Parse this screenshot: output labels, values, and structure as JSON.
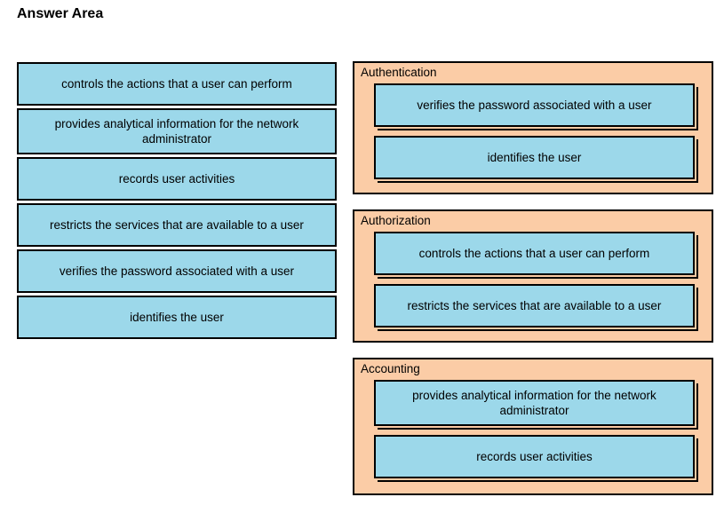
{
  "page": {
    "title": "Answer Area"
  },
  "colors": {
    "tile_fill": "#9CD8EA",
    "panel_fill": "#FBCCA6",
    "border": "#000000",
    "background": "#FFFFFF",
    "text": "#000000"
  },
  "source_list": {
    "items": [
      {
        "label": "controls the actions that a user can perform",
        "lines": 1
      },
      {
        "label": "provides analytical information for the network administrator",
        "lines": 2
      },
      {
        "label": "records user activities",
        "lines": 1
      },
      {
        "label": "restricts the services that are available to a user",
        "lines": 1
      },
      {
        "label": "verifies the password associated with a user",
        "lines": 1
      },
      {
        "label": "identifies the user",
        "lines": 1
      }
    ]
  },
  "drop_panels": [
    {
      "header": "Authentication",
      "tiles": [
        {
          "label": "verifies the password associated with a user",
          "lines": 1
        },
        {
          "label": "identifies the user",
          "lines": 1
        }
      ]
    },
    {
      "header": "Authorization",
      "tiles": [
        {
          "label": "controls the actions that a user can perform",
          "lines": 1
        },
        {
          "label": "restricts the services that are available to a user",
          "lines": 1
        }
      ]
    },
    {
      "header": "Accounting",
      "tiles": [
        {
          "label": "provides analytical information for the network administrator",
          "lines": 2
        },
        {
          "label": "records user activities",
          "lines": 1
        }
      ]
    }
  ]
}
